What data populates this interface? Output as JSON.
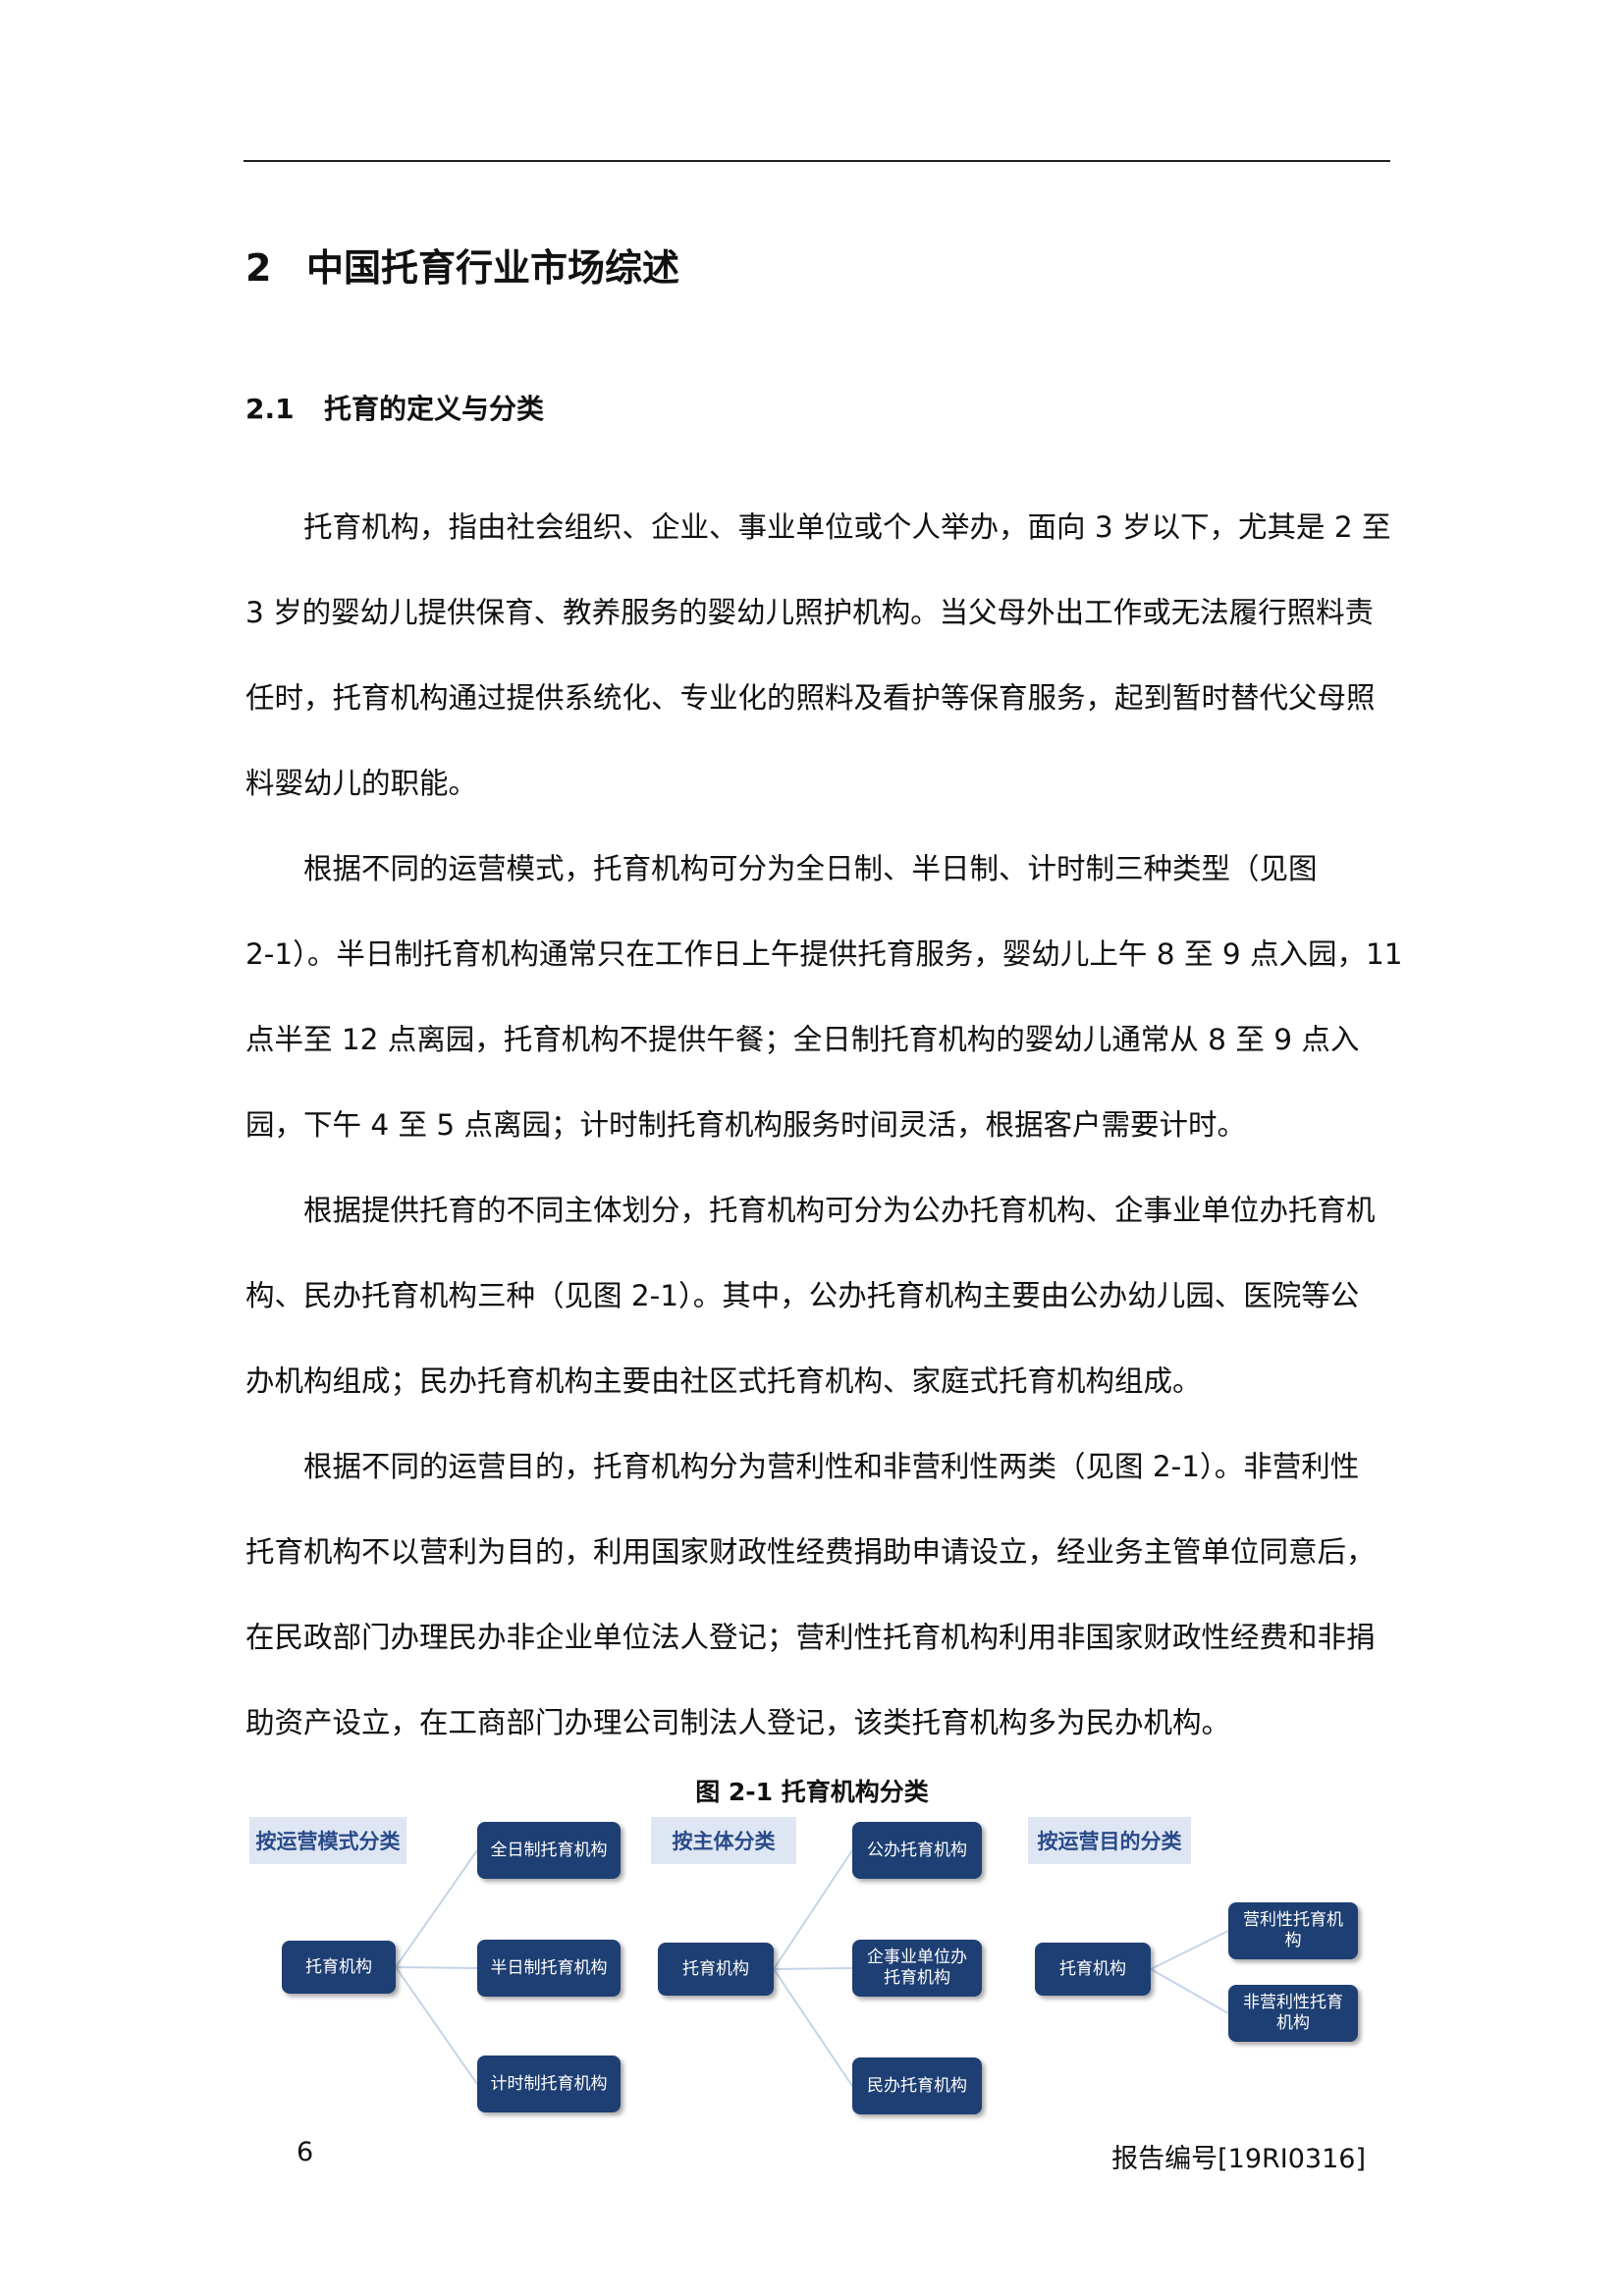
{
  "heading1": {
    "number": "2",
    "title": "中国托育行业市场综述"
  },
  "heading2": {
    "number": "2.1",
    "title": "托育的定义与分类"
  },
  "paragraphs": [
    [
      "　　托育机构，指由社会组织、企业、事业单位或个人举办，面向 3 岁以下，尤其是 2 至",
      "3 岁的婴幼儿提供保育、教养服务的婴幼儿照护机构。当父母外出工作或无法履行照料责",
      "任时，托育机构通过提供系统化、专业化的照料及看护等保育服务，起到暂时替代父母照",
      "料婴幼儿的职能。"
    ],
    [
      "　　根据不同的运营模式，托育机构可分为全日制、半日制、计时制三种类型（见图",
      "2-1）。半日制托育机构通常只在工作日上午提供托育服务，婴幼儿上午 8 至 9 点入园，11",
      "点半至 12 点离园，托育机构不提供午餐；全日制托育机构的婴幼儿通常从 8 至 9 点入",
      "园，下午 4 至 5 点离园；计时制托育机构服务时间灵活，根据客户需要计时。"
    ],
    [
      "　　根据提供托育的不同主体划分，托育机构可分为公办托育机构、企事业单位办托育机",
      "构、民办托育机构三种（见图 2-1）。其中，公办托育机构主要由公办幼儿园、医院等公",
      "办机构组成；民办托育机构主要由社区式托育机构、家庭式托育机构组成。"
    ],
    [
      "　　根据不同的运营目的，托育机构分为营利性和非营利性两类（见图 2-1）。非营利性",
      "托育机构不以营利为目的，利用国家财政性经费捐助申请设立，经业务主管单位同意后，",
      "在民政部门办理民办非企业单位法人登记；营利性托育机构利用非国家财政性经费和非捐",
      "助资产设立，在工商部门办理公司制法人登记，该类托育机构多为民办机构。"
    ]
  ],
  "figure": {
    "caption": "图 2-1 托育机构分类",
    "colors": {
      "header_bg": "#dde6f2",
      "header_text": "#2a4a8a",
      "node_bg": "#1e3f73",
      "connector": "#c5d4e8"
    },
    "groups": [
      {
        "header": "按运营模式分类",
        "root": "托育机构",
        "children": [
          "全日制托育机构",
          "半日制托育机构",
          "计时制托育机构"
        ]
      },
      {
        "header": "按主体分类",
        "root": "托育机构",
        "children": [
          "公办托育机构",
          "企事业单位办\n托育机构",
          "民办托育机构"
        ]
      },
      {
        "header": "按运营目的分类",
        "root": "托育机构",
        "children": [
          "营利性托育机\n构",
          "非营利性托育\n机构"
        ]
      }
    ]
  },
  "footer": {
    "page_number": "6",
    "report_number": "报告编号[19RI0316]"
  }
}
